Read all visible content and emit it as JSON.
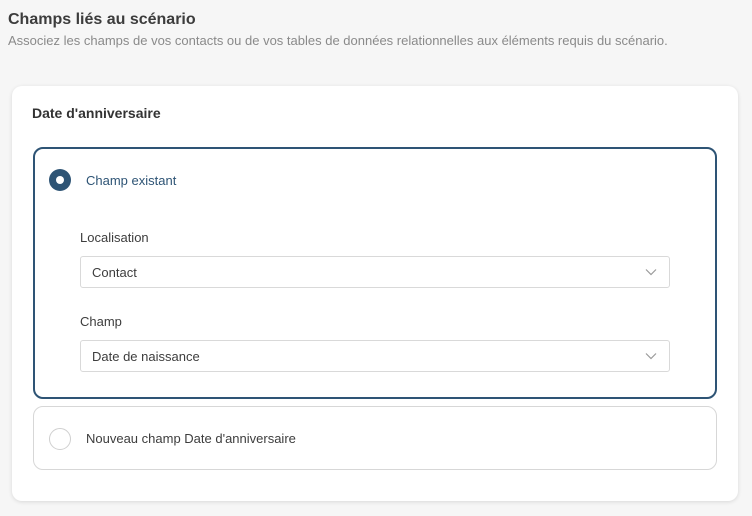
{
  "section": {
    "title": "Champs liés au scénario",
    "subtitle": "Associez les champs de vos contacts ou de vos tables de données relationnelles aux éléments requis du scénario."
  },
  "card": {
    "title": "Date d'anniversaire",
    "options": [
      {
        "label": "Champ existant",
        "selected": true,
        "fields": [
          {
            "label": "Localisation",
            "value": "Contact",
            "icon": "chevron-down-icon"
          },
          {
            "label": "Champ",
            "value": "Date de naissance",
            "icon": "chevron-down-icon"
          }
        ]
      },
      {
        "label": "Nouveau champ Date d'anniversaire",
        "selected": false
      }
    ]
  },
  "colors": {
    "accent": "#2e5475",
    "border": "#d7d7d7",
    "background": "#f6f6f6"
  }
}
